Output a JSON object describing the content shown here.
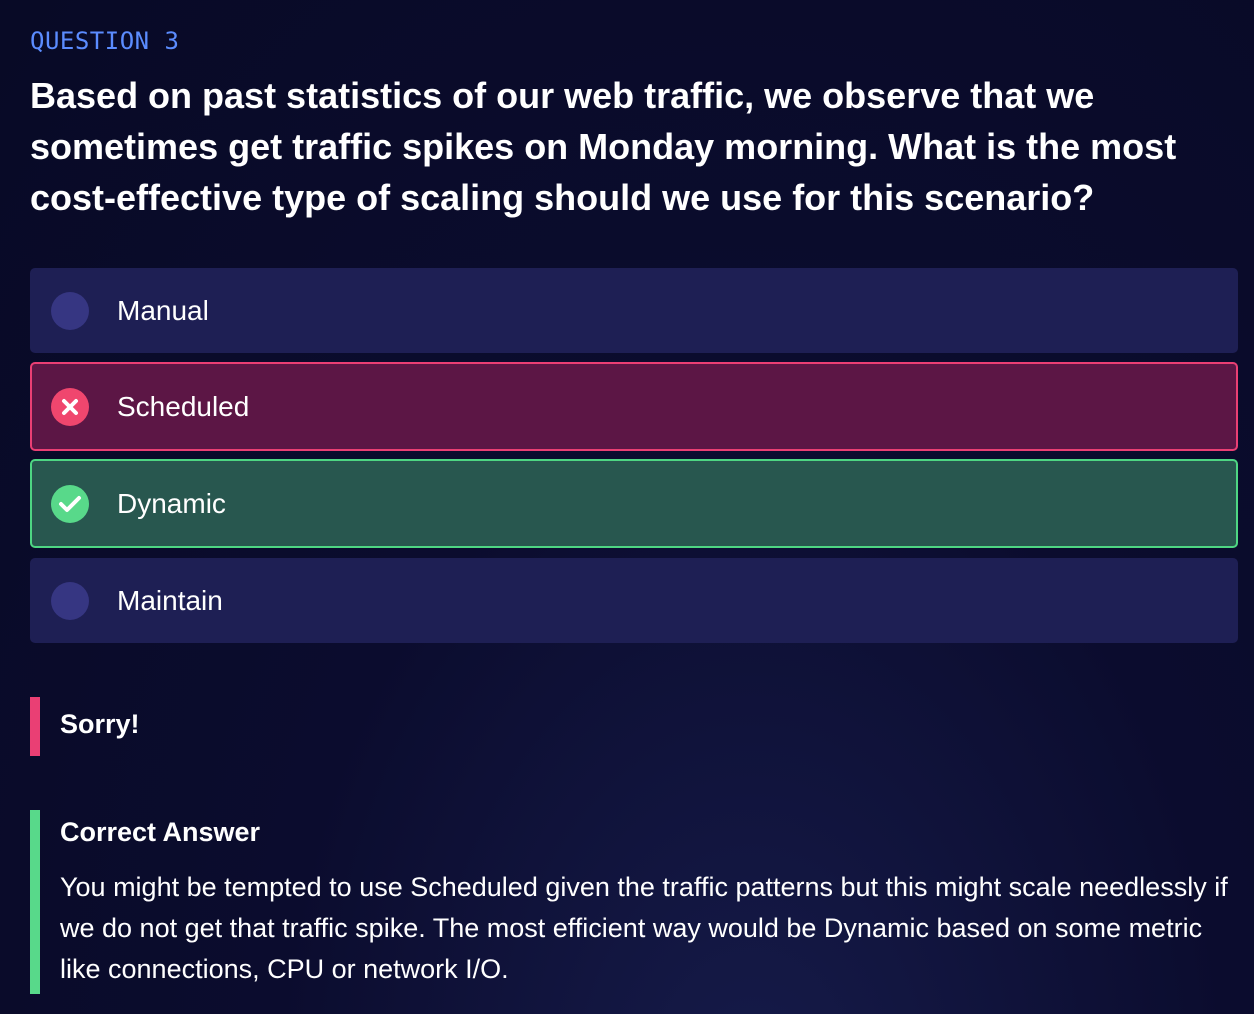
{
  "question": {
    "number_label": "QUESTION 3",
    "text": "Based on past statistics of our web traffic, we observe that we sometimes get traffic spikes on Monday morning. What is the most cost-effective type of scaling should we use for this scenario?"
  },
  "options": [
    {
      "label": "Manual",
      "state": "default"
    },
    {
      "label": "Scheduled",
      "state": "wrong"
    },
    {
      "label": "Dynamic",
      "state": "correct"
    },
    {
      "label": "Maintain",
      "state": "default"
    }
  ],
  "feedback": {
    "result_title": "Sorry!",
    "correct_title": "Correct Answer",
    "explanation": "You might be tempted to use Scheduled given the traffic patterns but this might scale needlessly if we do not get that traffic spike. The most efficient way would be Dynamic based on some metric like connections, CPU or network I/O."
  },
  "colors": {
    "accent_blue": "#5b8cff",
    "wrong": "#ea3f74",
    "correct": "#58d98a",
    "option_bg": "#1e1f54"
  }
}
